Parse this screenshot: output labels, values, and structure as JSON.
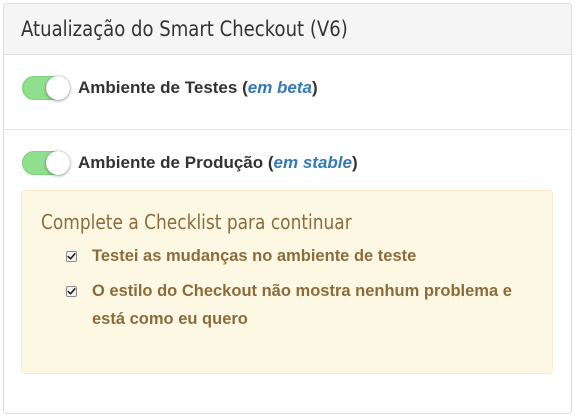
{
  "header": {
    "title": "Atualização do Smart Checkout (V6)"
  },
  "test_env": {
    "enabled": true,
    "label_prefix": "Ambiente de Testes (",
    "stage": "em beta",
    "label_suffix": ")"
  },
  "prod_env": {
    "enabled": true,
    "label_prefix": "Ambiente de Produção (",
    "stage": "em stable",
    "label_suffix": ")"
  },
  "checklist": {
    "title": "Complete a Checklist para continuar",
    "items": [
      {
        "label": "Testei as mudanças no ambiente de teste",
        "checked": true
      },
      {
        "label": "O estilo do Checkout não mostra nenhum problema e está como eu quero",
        "checked": true
      }
    ]
  },
  "colors": {
    "toggle_on": "#8fdf8f",
    "stage_link": "#337ab7",
    "alert_bg": "#fcf8e3",
    "alert_text": "#8a6d3b"
  }
}
